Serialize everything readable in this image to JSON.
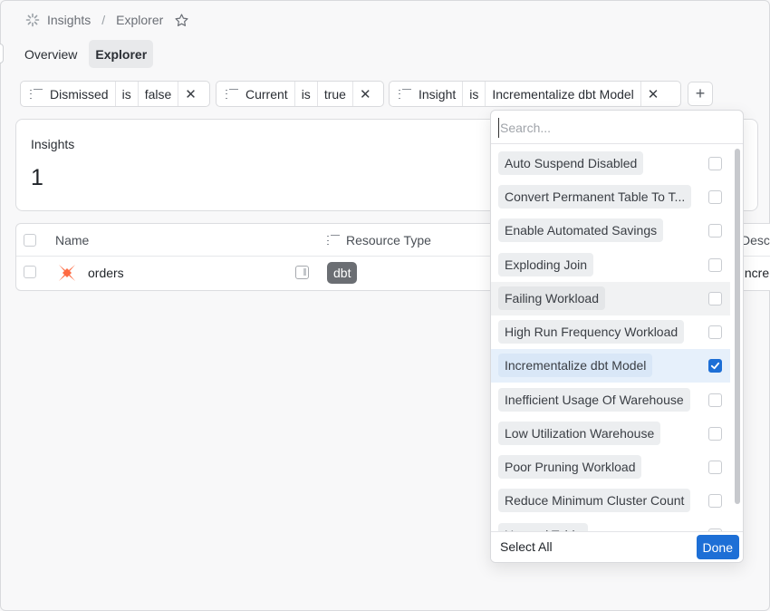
{
  "breadcrumb": {
    "root": "Insights",
    "separator": "/",
    "current": "Explorer"
  },
  "tabs": [
    {
      "label": "Overview",
      "active": false
    },
    {
      "label": "Explorer",
      "active": true
    }
  ],
  "filters": [
    {
      "field": "Dismissed",
      "op": "is",
      "value": "false"
    },
    {
      "field": "Current",
      "op": "is",
      "value": "true"
    },
    {
      "field": "Insight",
      "op": "is",
      "value": "Incrementalize dbt Model"
    }
  ],
  "add_filter_label": "+",
  "card": {
    "label": "Insights",
    "value": "1"
  },
  "table": {
    "columns": [
      "Name",
      "Resource Type",
      "Descr"
    ],
    "rows": [
      {
        "name": "orders",
        "resource_type": "dbt",
        "description": "Increm"
      }
    ]
  },
  "dropdown": {
    "search_placeholder": "Search...",
    "items": [
      {
        "label": "Auto Suspend Disabled",
        "checked": false
      },
      {
        "label": "Convert Permanent Table To T...",
        "checked": false
      },
      {
        "label": "Enable Automated Savings",
        "checked": false
      },
      {
        "label": "Exploding Join",
        "checked": false
      },
      {
        "label": "Failing Workload",
        "checked": false
      },
      {
        "label": "High Run Frequency Workload",
        "checked": false
      },
      {
        "label": "Incrementalize dbt Model",
        "checked": true
      },
      {
        "label": "Inefficient Usage Of Warehouse",
        "checked": false
      },
      {
        "label": "Low Utilization Warehouse",
        "checked": false
      },
      {
        "label": "Poor Pruning Workload",
        "checked": false
      },
      {
        "label": "Reduce Minimum Cluster Count",
        "checked": false
      },
      {
        "label": "Unused Table",
        "checked": false
      }
    ],
    "select_all_label": "Select All",
    "done_label": "Done"
  },
  "colors": {
    "accent": "#1d6fd6",
    "dbt_orange": "#fe6a42",
    "badge_gray": "#6b6e73"
  }
}
